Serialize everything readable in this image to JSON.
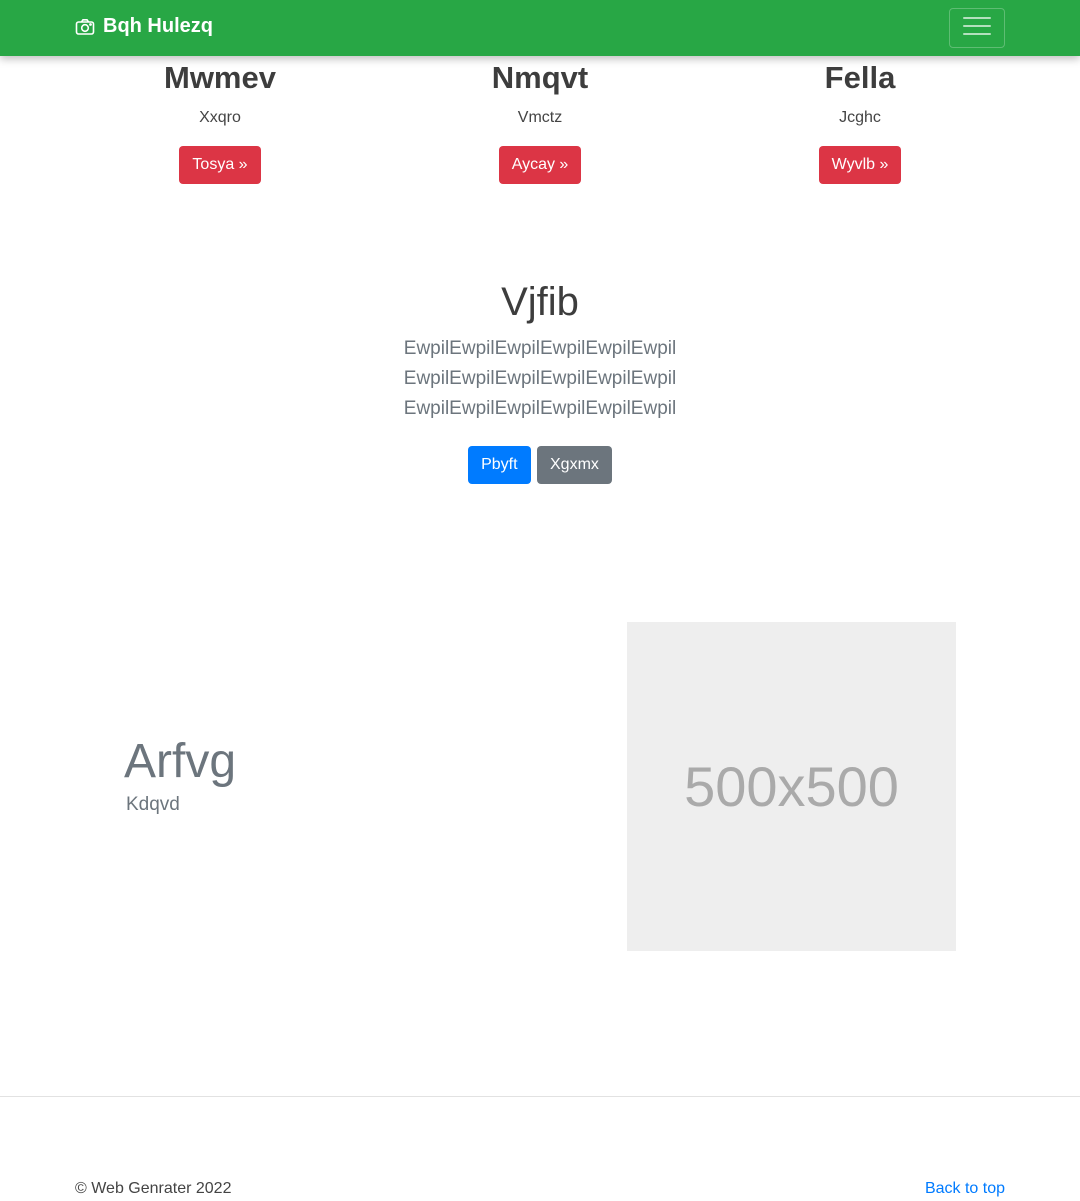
{
  "navbar": {
    "brand": "Bqh Hulezq",
    "brand_icon": "camera-icon",
    "toggler_icon": "hamburger-menu-icon",
    "background": "#28a745"
  },
  "columns": [
    {
      "title": "Mwmev",
      "text": "Xxqro",
      "button": "Tosya »"
    },
    {
      "title": "Nmqvt",
      "text": "Vmctz",
      "button": "Aycay »"
    },
    {
      "title": "Fella",
      "text": "Jcghc",
      "button": "Wyvlb »"
    }
  ],
  "hero": {
    "title": "Vjfib",
    "lead": "EwpilEwpilEwpilEwpilEwpilEwpil EwpilEwpilEwpilEwpilEwpilEwpil EwpilEwpilEwpilEwpilEwpilEwpil",
    "primary_button": "Pbyft",
    "secondary_button": "Xgxmx"
  },
  "feature": {
    "heading": "Arfvg",
    "subheading": "Kdqvd",
    "placeholder_text": "500x500"
  },
  "footer": {
    "copyright": "© Web Genrater 2022",
    "back_to_top": "Back to top"
  },
  "colors": {
    "danger": "#dc3545",
    "primary": "#007bff",
    "secondary": "#6c757d"
  }
}
